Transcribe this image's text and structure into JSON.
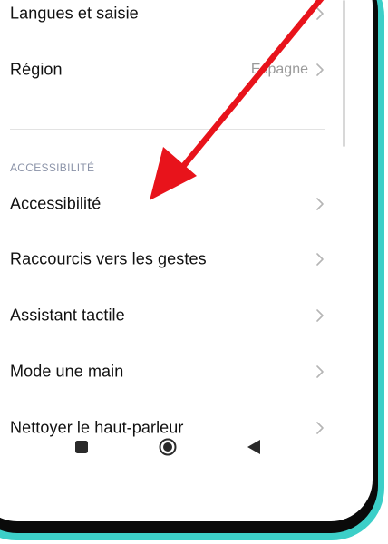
{
  "settings": {
    "rows": [
      {
        "label": "Langues et saisie",
        "value": ""
      },
      {
        "label": "Région",
        "value": "Espagne"
      },
      {
        "label": "Accessibilité",
        "value": ""
      },
      {
        "label": "Raccourcis vers les gestes",
        "value": ""
      },
      {
        "label": "Assistant tactile",
        "value": ""
      },
      {
        "label": "Mode une main",
        "value": ""
      },
      {
        "label": "Nettoyer le haut-parleur",
        "value": ""
      }
    ],
    "section_header": "ACCESSIBILITÉ"
  },
  "navbar": {
    "buttons": [
      "recents-button",
      "home-button",
      "back-button"
    ]
  },
  "colors": {
    "frame_edge": "#3ccfc8",
    "bezel": "#0a0a0a",
    "annotation_arrow": "#e8131b",
    "section_header": "#8b93a8"
  }
}
